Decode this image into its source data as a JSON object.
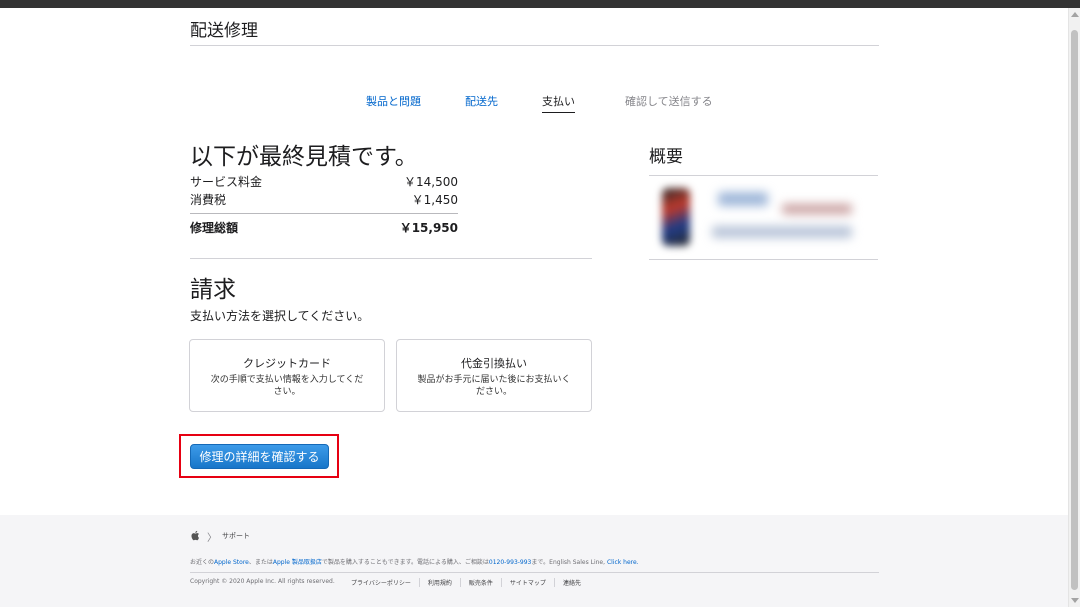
{
  "header": {
    "title": "配送修理"
  },
  "steps": [
    {
      "label": "製品と問題",
      "state": "link"
    },
    {
      "label": "配送先",
      "state": "link"
    },
    {
      "label": "支払い",
      "state": "active"
    },
    {
      "label": "確認して送信する",
      "state": "disabled"
    }
  ],
  "estimate": {
    "title": "以下が最終見積です。",
    "rows": [
      {
        "label": "サービス料金",
        "value": "￥14,500"
      },
      {
        "label": "消費税",
        "value": "￥1,450"
      }
    ],
    "total": {
      "label": "修理総額",
      "value": "￥15,950"
    }
  },
  "billing": {
    "title": "請求",
    "subtitle": "支払い方法を選択してください。",
    "options": [
      {
        "title": "クレジットカード",
        "description": "次の手順で支払い情報を入力してください。"
      },
      {
        "title": "代金引換払い",
        "description": "製品がお手元に届いた後にお支払いください。"
      }
    ],
    "confirm_label": "修理の詳細を確認する"
  },
  "summary": {
    "title": "概要"
  },
  "footer": {
    "apple_icon": "apple-logo-icon",
    "breadcrumb_chevron": "〉",
    "breadcrumb_support": "サポート",
    "info_prefix": "お近くの",
    "info_link_store": "Apple Store",
    "info_mid1": "、または",
    "info_link_reseller": "Apple 製品取扱店",
    "info_mid2": "で製品を購入することもできます。電話による購入、ご相談は",
    "info_link_phone": "0120-993-993",
    "info_mid3": "まで。English Sales Line,",
    "info_link_click": "Click here.",
    "copyright": "Copyright © 2020 Apple Inc. All rights reserved.",
    "links": [
      "プライバシーポリシー",
      "利用規約",
      "販売条件",
      "サイトマップ",
      "連絡先"
    ]
  },
  "colors": {
    "link": "#0066cc",
    "button": "#1876c9",
    "highlight_border": "#e60012"
  }
}
